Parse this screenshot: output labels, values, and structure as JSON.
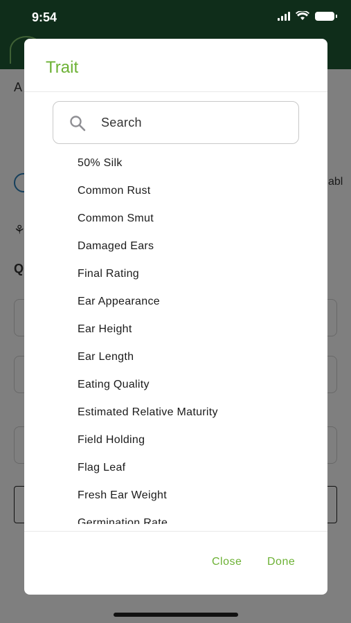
{
  "status_bar": {
    "time": "9:54"
  },
  "background": {
    "letter_a": "A",
    "letter_q": "Q",
    "partial_text": "abl"
  },
  "modal": {
    "title": "Trait",
    "search": {
      "placeholder": "Search"
    },
    "items": [
      "50% Silk",
      "Common Rust",
      "Common Smut",
      "Damaged Ears",
      "Final Rating",
      "Ear Appearance",
      "Ear Height",
      "Ear Length",
      "Eating Quality",
      "Estimated Relative Maturity",
      "Field Holding",
      "Flag Leaf",
      "Fresh Ear Weight",
      "Germination Rate"
    ],
    "close_label": "Close",
    "done_label": "Done"
  },
  "colors": {
    "accent": "#6cb134",
    "header": "#1e5a34"
  }
}
